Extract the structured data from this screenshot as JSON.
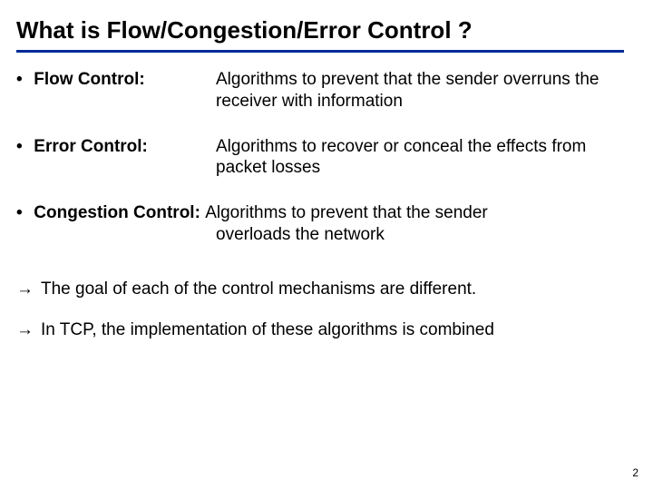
{
  "title": "What is Flow/Congestion/Error Control ?",
  "items": [
    {
      "label": " Flow Control:",
      "definition": "Algorithms to prevent that the sender overruns the receiver with information"
    },
    {
      "label": " Error Control:",
      "definition": "Algorithms to recover or conceal the effects from packet losses"
    },
    {
      "label": " Congestion Control:",
      "def_line1": " Algorithms to prevent that the sender",
      "def_line2": "overloads the network"
    }
  ],
  "notes": [
    "The goal of each of the control mechanisms are different.",
    "In TCP, the implementation of these algorithms is combined"
  ],
  "page_number": "2"
}
